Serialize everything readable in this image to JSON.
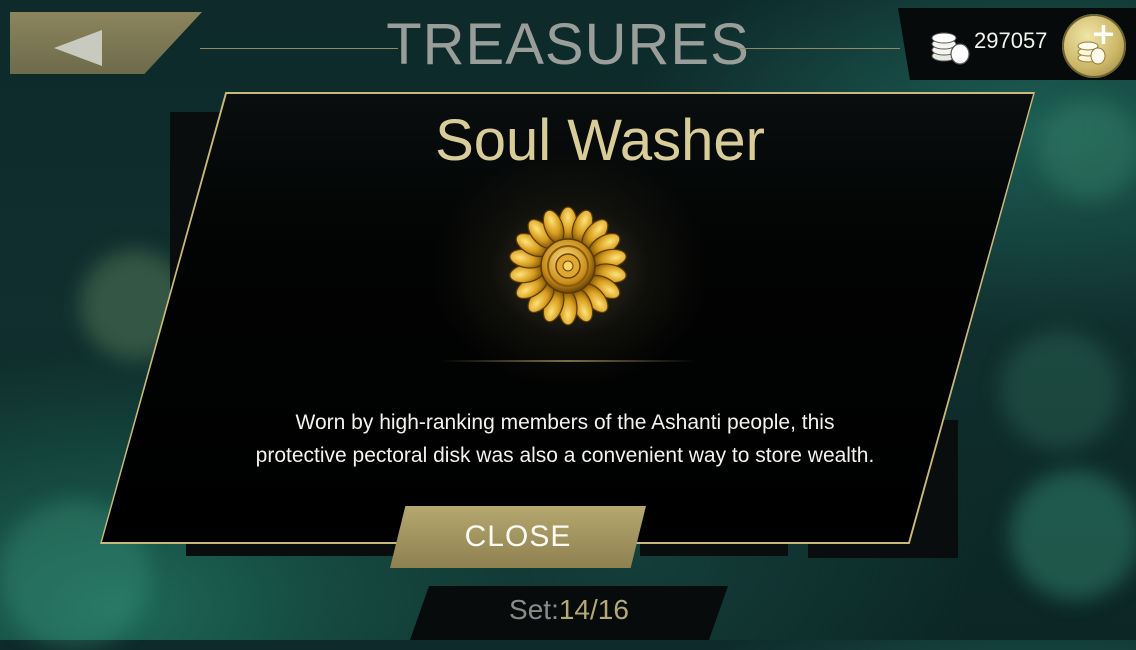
{
  "header": {
    "title": "TREASURES",
    "back_icon": "back-arrow-icon",
    "coins": "297057",
    "coins_icon": "coin-stack-icon",
    "add_icon": "add-coins-icon"
  },
  "modal": {
    "name": "Soul Washer",
    "image_icon": "gold-flower-disk-icon",
    "description_line1": "Worn by high-ranking members of the Ashanti people, this",
    "description_line2": "protective pectoral disk was also a convenient way to store wealth.",
    "close_label": "CLOSE"
  },
  "footer": {
    "set_label": "Set:",
    "set_value": "14/16"
  },
  "colors": {
    "gold": "#c9b97a",
    "title_gray": "#9a9e9a",
    "text_white": "#f2f2ee",
    "background": "#0e2a2b"
  }
}
